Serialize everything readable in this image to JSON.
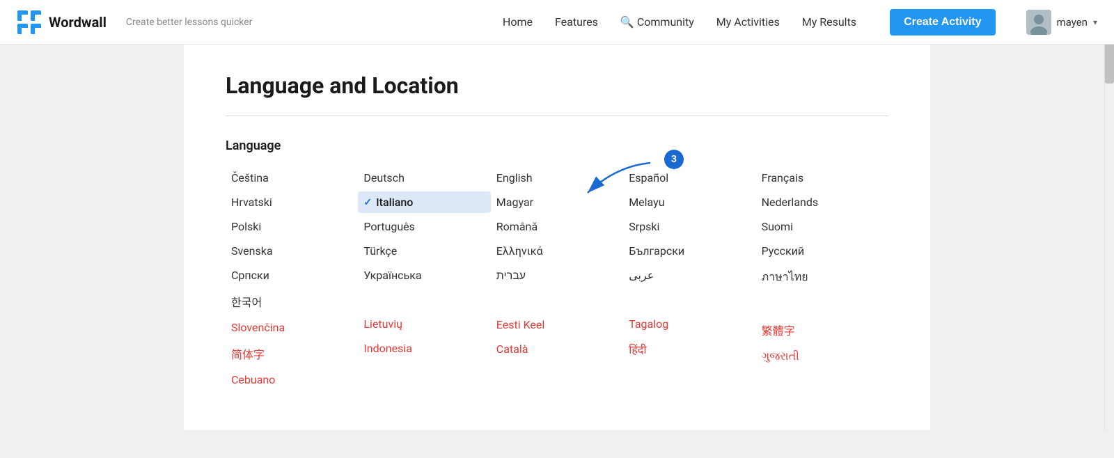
{
  "header": {
    "logo_text": "Wordwall",
    "tagline": "Create better lessons quicker",
    "nav": {
      "home": "Home",
      "features": "Features",
      "community": "Community",
      "my_activities": "My Activities",
      "my_results": "My Results"
    },
    "create_button": "Create Activity",
    "user_name": "mayen"
  },
  "page": {
    "title": "Language and Location",
    "section_label": "Language",
    "annotation_number": "3"
  },
  "languages": {
    "col1": [
      {
        "label": "Čeština",
        "coming_soon": false,
        "selected": false
      },
      {
        "label": "Hrvatski",
        "coming_soon": false,
        "selected": false
      },
      {
        "label": "Polski",
        "coming_soon": false,
        "selected": false
      },
      {
        "label": "Svenska",
        "coming_soon": false,
        "selected": false
      },
      {
        "label": "Српски",
        "coming_soon": false,
        "selected": false
      },
      {
        "label": "한국어",
        "coming_soon": false,
        "selected": false
      },
      {
        "label": "Slovenčina",
        "coming_soon": true,
        "selected": false
      },
      {
        "label": "简体字",
        "coming_soon": true,
        "selected": false
      },
      {
        "label": "Cebuano",
        "coming_soon": true,
        "selected": false
      }
    ],
    "col2": [
      {
        "label": "Deutsch",
        "coming_soon": false,
        "selected": false
      },
      {
        "label": "Italiano",
        "coming_soon": false,
        "selected": true
      },
      {
        "label": "Português",
        "coming_soon": false,
        "selected": false
      },
      {
        "label": "Türkçe",
        "coming_soon": false,
        "selected": false
      },
      {
        "label": "Українська",
        "coming_soon": false,
        "selected": false
      },
      {
        "label": "",
        "coming_soon": false,
        "selected": false
      },
      {
        "label": "Lietuvių",
        "coming_soon": true,
        "selected": false
      },
      {
        "label": "Indonesia",
        "coming_soon": true,
        "selected": false
      }
    ],
    "col3": [
      {
        "label": "English",
        "coming_soon": false,
        "selected": false
      },
      {
        "label": "Magyar",
        "coming_soon": false,
        "selected": false
      },
      {
        "label": "Română",
        "coming_soon": false,
        "selected": false
      },
      {
        "label": "Ελληνικά",
        "coming_soon": false,
        "selected": false
      },
      {
        "label": "עברית",
        "coming_soon": false,
        "selected": false
      },
      {
        "label": "",
        "coming_soon": false,
        "selected": false
      },
      {
        "label": "Eesti Keel",
        "coming_soon": true,
        "selected": false
      },
      {
        "label": "Català",
        "coming_soon": true,
        "selected": false
      }
    ],
    "col4": [
      {
        "label": "Español",
        "coming_soon": false,
        "selected": false
      },
      {
        "label": "Melayu",
        "coming_soon": false,
        "selected": false
      },
      {
        "label": "Srpski",
        "coming_soon": false,
        "selected": false
      },
      {
        "label": "Български",
        "coming_soon": false,
        "selected": false
      },
      {
        "label": "عربى",
        "coming_soon": false,
        "selected": false
      },
      {
        "label": "",
        "coming_soon": false,
        "selected": false
      },
      {
        "label": "Tagalog",
        "coming_soon": true,
        "selected": false
      },
      {
        "label": "हिंदी",
        "coming_soon": true,
        "selected": false
      }
    ],
    "col5": [
      {
        "label": "Français",
        "coming_soon": false,
        "selected": false
      },
      {
        "label": "Nederlands",
        "coming_soon": false,
        "selected": false
      },
      {
        "label": "Suomi",
        "coming_soon": false,
        "selected": false
      },
      {
        "label": "Русский",
        "coming_soon": false,
        "selected": false
      },
      {
        "label": "ภาษาไทย",
        "coming_soon": false,
        "selected": false
      },
      {
        "label": "",
        "coming_soon": false,
        "selected": false
      },
      {
        "label": "繁體字",
        "coming_soon": true,
        "selected": false
      },
      {
        "label": "ગુજરાતી",
        "coming_soon": true,
        "selected": false
      }
    ]
  }
}
